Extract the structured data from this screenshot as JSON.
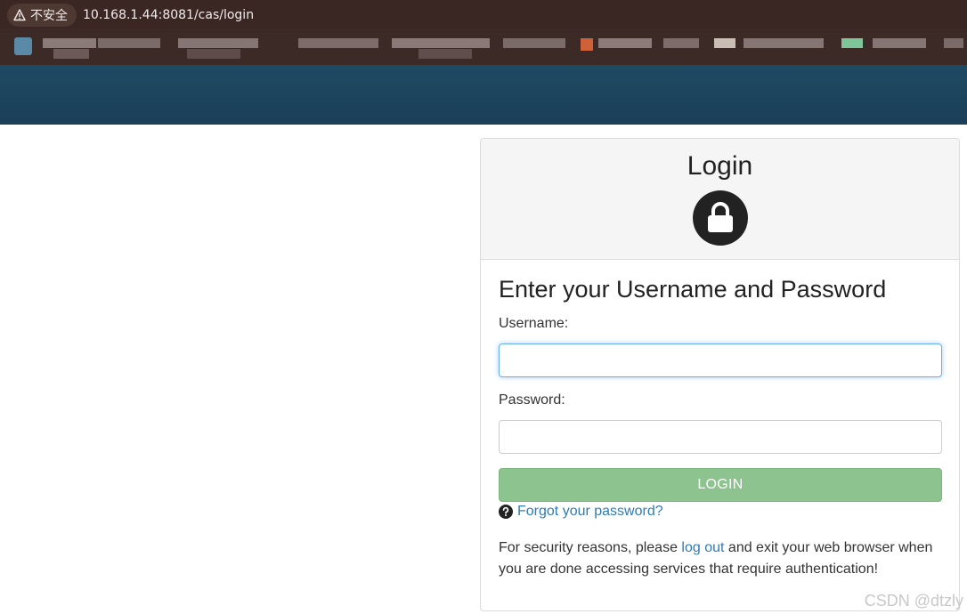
{
  "browser": {
    "security_label": "不安全",
    "url": "10.168.1.44:8081/cas/login"
  },
  "card": {
    "title": "Login",
    "heading": "Enter your Username and Password",
    "username_label": "Username:",
    "username_value": "",
    "password_label": "Password:",
    "password_value": "",
    "login_button": "LOGIN",
    "forgot_link": "Forgot your password?",
    "security_before": "For security reasons, please ",
    "logout_link": "log out",
    "security_after": " and exit your web browser when you are done accessing services that require authentication!"
  },
  "watermark": "CSDN @dtzly",
  "colors": {
    "banner": "#1f4a63",
    "login_button": "#8cc38e",
    "link": "#2f7bb5"
  },
  "icons": [
    "warning-icon",
    "lock-icon",
    "question-circle-icon"
  ]
}
